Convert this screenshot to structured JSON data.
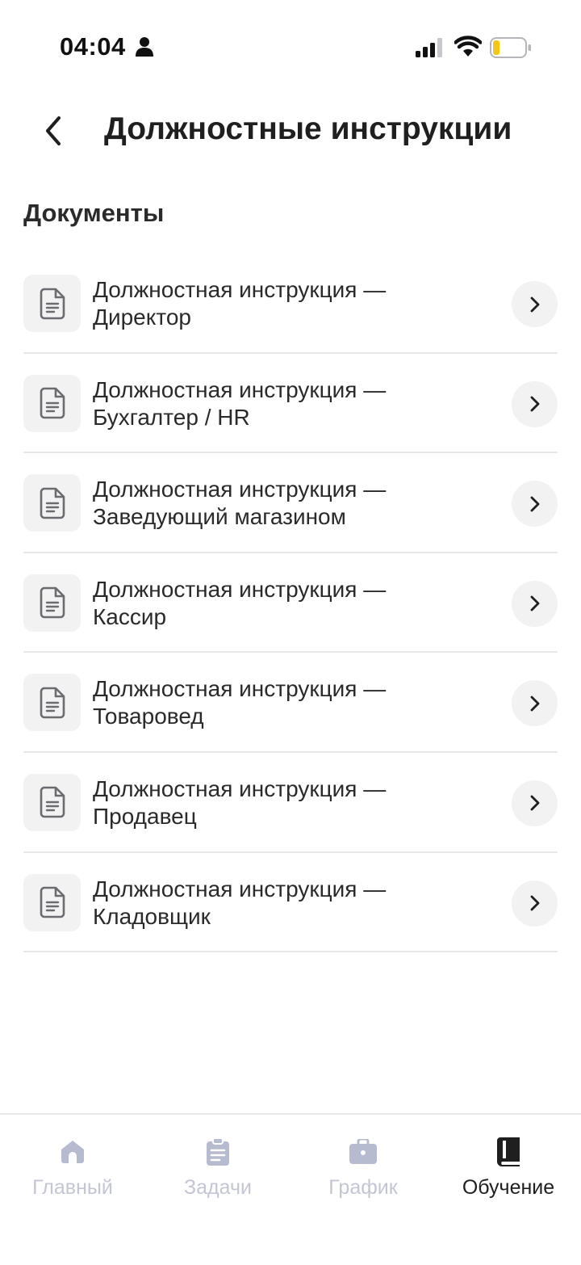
{
  "status_bar": {
    "time": "04:04",
    "icons": [
      "person-icon",
      "signal-icon",
      "wifi-icon",
      "battery-icon"
    ],
    "battery_color": "#f5c518"
  },
  "header": {
    "title": "Должностные инструкции",
    "back_icon": "chevron-left-icon"
  },
  "section": {
    "title": "Документы"
  },
  "documents": [
    {
      "line1": "Должностная инструкция —",
      "line2": "Директор"
    },
    {
      "line1": "Должностная инструкция —",
      "line2": "Бухгалтер / HR"
    },
    {
      "line1": "Должностная инструкция —",
      "line2": "Заведующий магазином"
    },
    {
      "line1": "Должностная инструкция —",
      "line2": "Кассир"
    },
    {
      "line1": "Должностная инструкция —",
      "line2": "Товаровед"
    },
    {
      "line1": "Должностная инструкция —",
      "line2": "Продавец"
    },
    {
      "line1": "Должностная инструкция —",
      "line2": "Кладовщик"
    }
  ],
  "bottom_nav": {
    "items": [
      {
        "label": "Главный",
        "icon": "home-icon",
        "active": false
      },
      {
        "label": "Задачи",
        "icon": "clipboard-icon",
        "active": false
      },
      {
        "label": "График",
        "icon": "briefcase-icon",
        "active": false
      },
      {
        "label": "Обучение",
        "icon": "book-icon",
        "active": true
      }
    ],
    "inactive_color": "#c3c6d3",
    "active_color": "#1f1f1f"
  }
}
